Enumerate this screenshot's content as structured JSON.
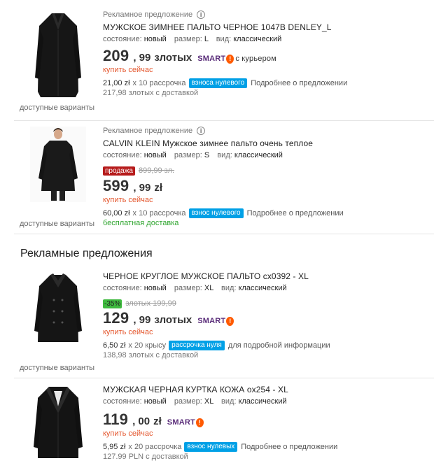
{
  "listings": [
    {
      "ad_label": "Рекламное предложение",
      "info_icon": "i",
      "title": "МУЖСКОЕ ЗИМНЕЕ ПАЛЬТО ЧЕРНОЕ 1047B DENLEY_L",
      "condition_label": "состояние:",
      "condition": "новый",
      "size_label": "размер:",
      "size": "L",
      "type_label": "вид:",
      "type": "классический",
      "price_main": "209",
      "price_frac": ", 99",
      "currency": "злотых",
      "smart": "SMART",
      "smart_icon": "!",
      "courier": "с курьером",
      "buy_now": "купить сейчас",
      "installment_amount": "21,00 zł",
      "installment_text": "x 10 рассрочка",
      "installment_badge": "взноса нулевого",
      "more_link": "Подробнее о предложении",
      "delivery": "217,98 злотых с доставкой",
      "variants": "доступные варианты"
    },
    {
      "ad_label": "Рекламное предложение",
      "info_icon": "i",
      "title": "CALVIN KLEIN Мужское зимнее пальто очень теплое",
      "condition_label": "состояние:",
      "condition": "новый",
      "size_label": "размер:",
      "size": "S",
      "type_label": "вид:",
      "type": "классический",
      "sale_badge": "продажа",
      "old_price": "899,99 зл.",
      "price_main": "599",
      "price_frac": ", 99",
      "currency": "zł",
      "buy_now": "купить сейчас",
      "installment_amount": "60,00 zł",
      "installment_text": "x 10 рассрочка",
      "installment_badge": "взнос нулевого",
      "more_link": "Подробнее о предложении",
      "delivery": "бесплатная доставка",
      "variants": "доступные варианты"
    },
    {
      "title": "ЧЕРНОЕ КРУГЛОЕ МУЖСКОЕ ПАЛЬТО cx0392 - XL",
      "condition_label": "состояние:",
      "condition": "новый",
      "size_label": "размер:",
      "size": "XL",
      "type_label": "вид:",
      "type": "классический",
      "discount_badge": "-35%",
      "old_price": "злотых 199,99",
      "price_main": "129",
      "price_frac": ", 99",
      "currency": "злотых",
      "smart": "SMART",
      "smart_icon": "!",
      "buy_now": "купить сейчас",
      "installment_amount": "6,50 zł",
      "installment_text": "x 20 крысу",
      "installment_badge": "рассрочка нуля",
      "more_link": "для подробной информации",
      "delivery": "138,98 злотых с доставкой",
      "variants": "доступные варианты"
    },
    {
      "title": "МУЖСКАЯ ЧЕРНАЯ КУРТКА КОЖА ox254 - XL",
      "condition_label": "состояние:",
      "condition": "новый",
      "size_label": "размер:",
      "size": "XL",
      "type_label": "вид:",
      "type": "классический",
      "price_main": "119",
      "price_frac": ", 00",
      "currency": "zł",
      "smart": "SMART",
      "smart_icon": "!",
      "buy_now": "купить сейчас",
      "installment_amount": "5,95 zł",
      "installment_text": "x 20 рассрочка",
      "installment_badge": "взнос нулевых",
      "more_link": "Подробнее о предложении",
      "delivery": "127.99 PLN с доставкой"
    }
  ],
  "section_heading": "Рекламные предложения",
  "colors": {
    "accent_blue": "#00a0e6",
    "sale_red": "#b61b1b",
    "discount_green": "#3fba3f",
    "buy_now_orange": "#e4572e",
    "smart_purple": "#5a2d7a",
    "smart_orange": "#ff5a00"
  }
}
